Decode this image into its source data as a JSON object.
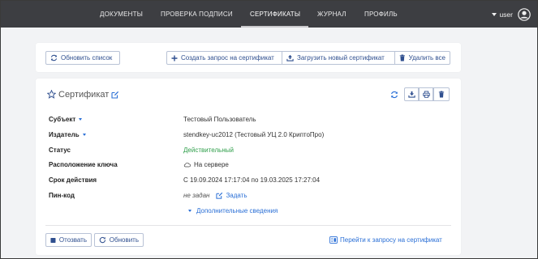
{
  "nav": {
    "items": [
      "ДОКУМЕНТЫ",
      "ПРОВЕРКА ПОДПИСИ",
      "СЕРТИФИКАТЫ",
      "ЖУРНАЛ",
      "ПРОФИЛЬ"
    ],
    "active": "СЕРТИФИКАТЫ",
    "user": "user"
  },
  "toolbar": {
    "refresh_list": "Обновить список",
    "create_request": "Создать запрос на сертификат",
    "upload_new": "Загрузить новый сертификат",
    "delete_all": "Удалить все"
  },
  "certificate": {
    "title": "Сертификат",
    "fields": {
      "subject_label": "Субъект",
      "subject_value": "Тестовый Пользователь",
      "issuer_label": "Издатель",
      "issuer_value": "stendkey-uc2012 (Тестовый УЦ 2.0 КриптоПро)",
      "status_label": "Статус",
      "status_value": "Действительный",
      "key_location_label": "Расположение ключа",
      "key_location_value": "На сервере",
      "validity_label": "Срок действия",
      "validity_value": "С 19.09.2024 17:17:04 по 19.03.2025 17:27:04",
      "pin_label": "Пин-код",
      "pin_value": "не задан",
      "pin_set_link": "Задать"
    },
    "more_info": "Дополнительные сведения",
    "revoke": "Отозвать",
    "renew": "Обновить",
    "goto_request": "Перейти к запросу на сертификат"
  },
  "colors": {
    "topbar": "#3d3e42",
    "accent": "#2a6fd6",
    "status_ok": "#2e9e4a",
    "danger": "#2f4f8f"
  }
}
